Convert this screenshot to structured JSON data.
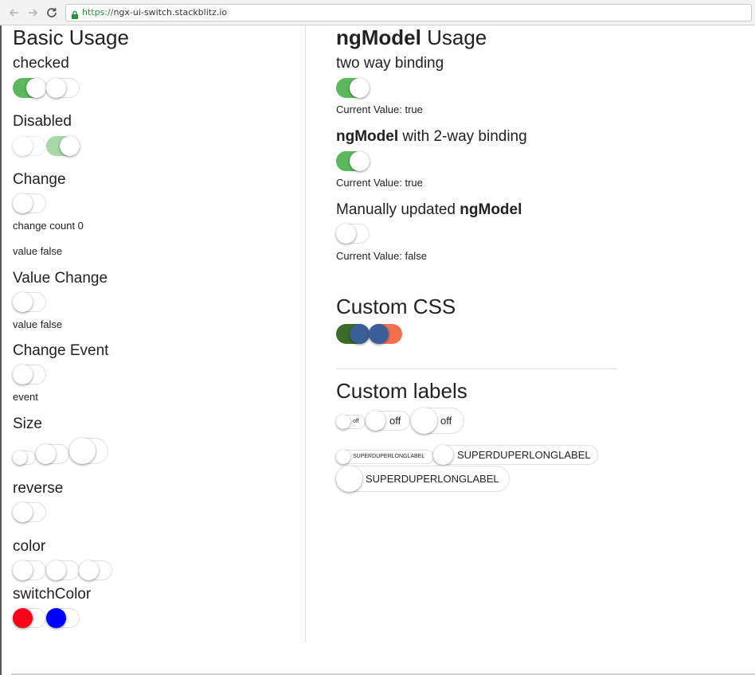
{
  "browser": {
    "url_scheme": "https://",
    "url_host": "ngx-ui-switch.stackblitz.io"
  },
  "left": {
    "title": "Basic Usage",
    "checked": "checked",
    "disabled": "Disabled",
    "change": "Change",
    "change_count": "change count 0",
    "change_value": "value false",
    "value_change": "Value Change",
    "value_change_value": "value false",
    "change_event": "Change Event",
    "event": "event",
    "size": "Size",
    "reverse": "reverse",
    "color": "color",
    "switch_color": "switchColor"
  },
  "right": {
    "title_bold": "ngModel",
    "title_rest": " Usage",
    "two_way": "two way binding",
    "two_way_value": "Current Value: true",
    "ngmodel_bold": "ngModel",
    "ngmodel_rest": " with 2-way binding",
    "ngmodel_value": "Current Value: true",
    "manual_prefix": "Manually updated ",
    "manual_bold": "ngModel",
    "manual_value": "Current Value: false",
    "custom_css": "Custom CSS",
    "custom_labels": "Custom labels",
    "label_off": "off",
    "label_long": "SUPERDUPERLONGLABEL"
  },
  "switches": {
    "checked_1": true,
    "checked_2": false,
    "disabled_1": false,
    "disabled_2": true,
    "change": false,
    "value_change": false,
    "change_event": false,
    "size_small": false,
    "size_medium": false,
    "size_large": false,
    "reverse": false,
    "color_1": false,
    "color_2": false,
    "color_3": false,
    "switch_color_1": false,
    "switch_color_2": false,
    "two_way": true,
    "ngmodel": true,
    "manual": false
  },
  "colors": {
    "on": "#5cb85c",
    "on_disabled": "#a8d8a8",
    "custom_dark_green": "#3d6b2a",
    "custom_blue": "#3a5f98",
    "custom_orange": "#f26f50",
    "switch_red": "#ff0018",
    "switch_blue": "#0000ff"
  }
}
